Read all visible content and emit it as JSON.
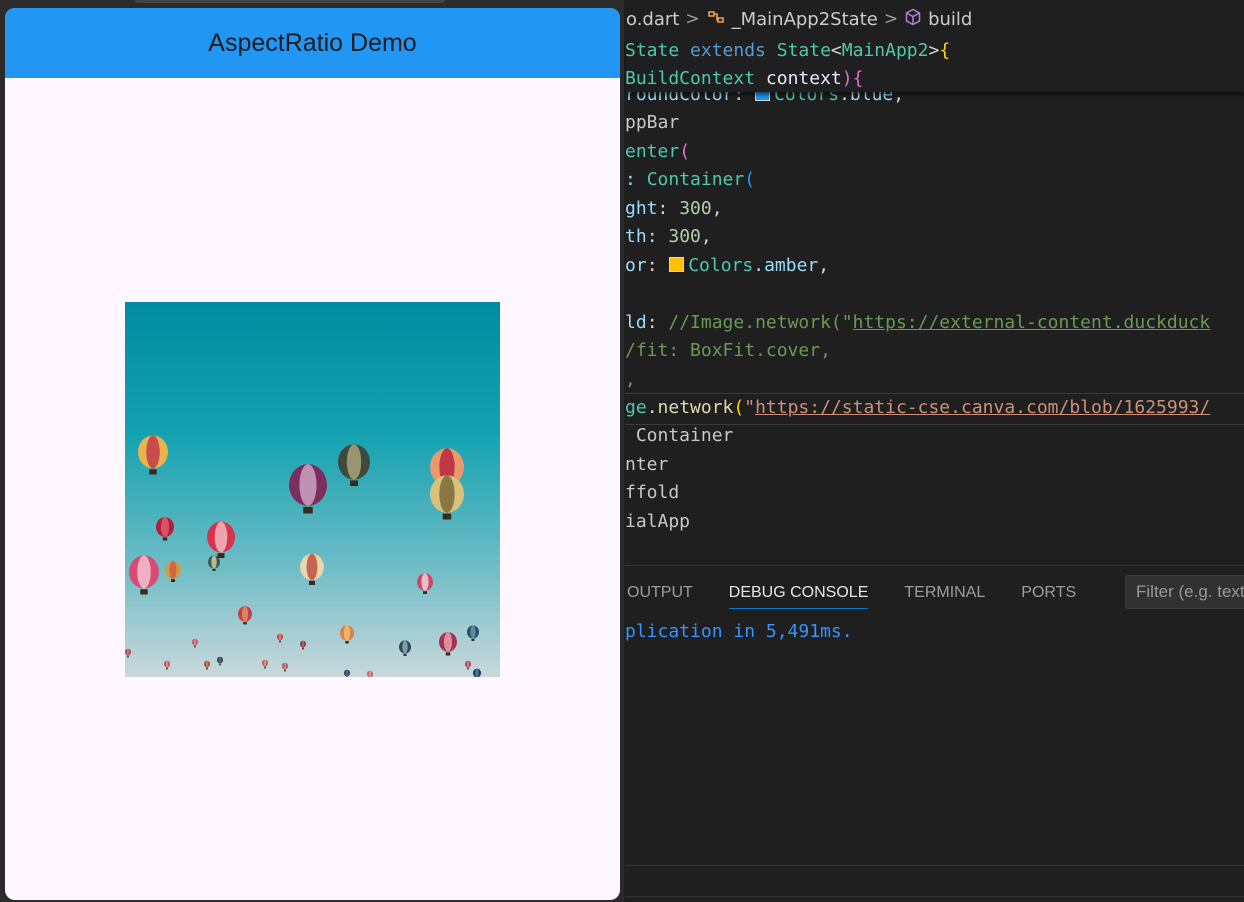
{
  "app": {
    "title": "AspectRatio Demo",
    "appbar_color": "#2196f3",
    "background_color": "#fef7ff",
    "image_description_icon": "hot-air-balloons-image"
  },
  "editor": {
    "breadcrumb": {
      "file": "o.dart",
      "class": "_MainApp2State",
      "method": "build"
    },
    "sticky_lines": [
      {
        "t1": "State ",
        "t2": "extends ",
        "t3": "State",
        "t4": "<",
        "t5": "MainApp2",
        "t6": ">",
        "t7": "{"
      },
      {
        "t1": "BuildContext ",
        "t2": "context",
        "t3": ")",
        "t4": "{"
      }
    ],
    "code": {
      "l1_a": "roundColor: ",
      "l1_b": "Colors",
      "l1_c": ".",
      "l1_d": "blue",
      "l1_e": ",",
      "l2": "ppBar",
      "l3_a": "enter",
      "l3_b": "(",
      "l4_a": ": ",
      "l4_b": "Container",
      "l4_c": "(",
      "l5_a": "ght",
      "l5_b": ": ",
      "l5_c": "300",
      "l5_d": ",",
      "l6_a": "th",
      "l6_b": ": ",
      "l6_c": "300",
      "l6_d": ",",
      "l7_a": "or",
      "l7_b": ":  ",
      "l7_c": "Colors",
      "l7_d": ".",
      "l7_e": "amber",
      "l7_f": ",",
      "l8_a": "ld",
      "l8_b": ": ",
      "l8_c": "//Image.network(\"",
      "l8_d": "https://external-content.duckduck",
      "l9": "/fit: BoxFit.cover,",
      "l10": ",",
      "l11_a": "ge",
      "l11_b": ".",
      "l11_c": "network",
      "l11_d": "(",
      "l11_e": "\"",
      "l11_f": "https://static-cse.canva.com/blob/1625993/",
      "l12": " Container",
      "l13": "nter",
      "l14": "ffold",
      "l15": "ialApp"
    },
    "swatch_colors": {
      "blue": "#2196f3",
      "amber": "#ffc107"
    },
    "panel": {
      "tabs": [
        "OUTPUT",
        "DEBUG CONSOLE",
        "TERMINAL",
        "PORTS"
      ],
      "active_tab": "DEBUG CONSOLE",
      "filter_placeholder": "Filter (e.g. text"
    },
    "console_line": "plication in 5,491ms."
  }
}
